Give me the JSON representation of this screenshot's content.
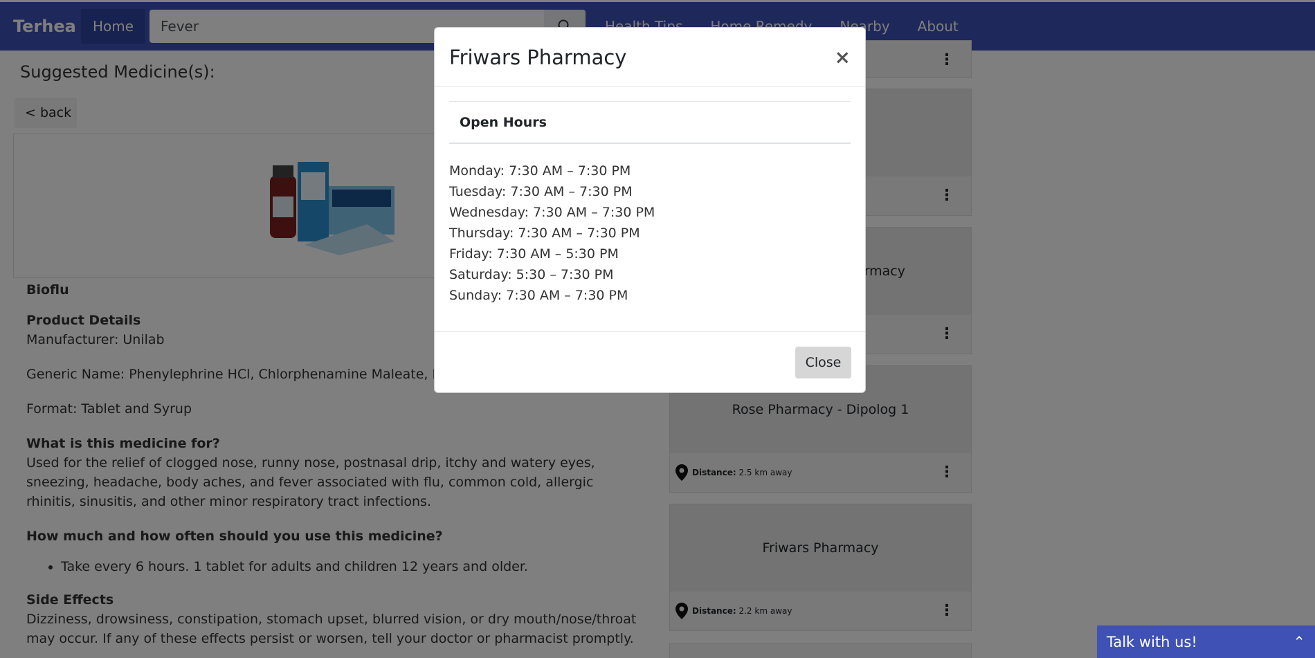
{
  "nav": {
    "brand": "Terhea",
    "home": "Home",
    "search_value": "Fever",
    "links": [
      "Health Tips",
      "Home Remedy",
      "Nearby",
      "About"
    ]
  },
  "page": {
    "heading": "Suggested Medicine(s):",
    "back": "< back"
  },
  "product": {
    "name": "Bioflu",
    "details_heading": "Product Details",
    "manufacturer": "Manufacturer: Unilab",
    "generic": "Generic Name: Phenylephrine HCl, Chlorphenamine Maleate, Parac",
    "format": "Format: Tablet and Syrup",
    "for_heading": "What is this medicine for?",
    "for_text": "Used for the relief of clogged nose, runny nose, postnasal drip, itchy and watery eyes, sneezing, headache, body aches, and fever associated with flu, common cold, allergic rhinitis, sinusitis, and other minor respiratory tract infections.",
    "usage_heading": "How much and how often should you use this medicine?",
    "usage_item": "Take every 6 hours. 1 tablet for adults and children 12 years and older.",
    "side_heading": "Side Effects",
    "side_text": "Dizziness, drowsiness, constipation, stomach upset, blurred vision, or dry mouth/nose/throat may occur. If any of these effects persist or worsen, tell your doctor or pharmacist promptly."
  },
  "pharmacies": [
    {
      "name": "",
      "distance_label": "",
      "distance": ""
    },
    {
      "name": "rmacy",
      "distance_label": "",
      "distance": ""
    },
    {
      "name": "Rose Pharmacy - Dipolog 1",
      "distance_label": "Distance:",
      "distance": "2.5 km away"
    },
    {
      "name": "Friwars Pharmacy",
      "distance_label": "Distance:",
      "distance": "2.2 km away"
    }
  ],
  "modal": {
    "title": "Friwars Pharmacy",
    "close_x": "×",
    "hours_heading": "Open Hours",
    "hours": [
      "Monday: 7:30 AM – 7:30 PM",
      "Tuesday: 7:30 AM – 7:30 PM",
      "Wednesday: 7:30 AM – 7:30 PM",
      "Thursday: 7:30 AM – 7:30 PM",
      "Friday: 7:30 AM – 5:30 PM",
      "Saturday: 5:30 – 7:30 PM",
      "Sunday: 7:30 AM – 7:30 PM"
    ],
    "close_button": "Close"
  },
  "chat": {
    "label": "Talk with us!",
    "toggle": "⌃"
  },
  "colors": {
    "primary": "#3f51b5",
    "backdrop": "rgba(0,0,0,0.5)"
  }
}
